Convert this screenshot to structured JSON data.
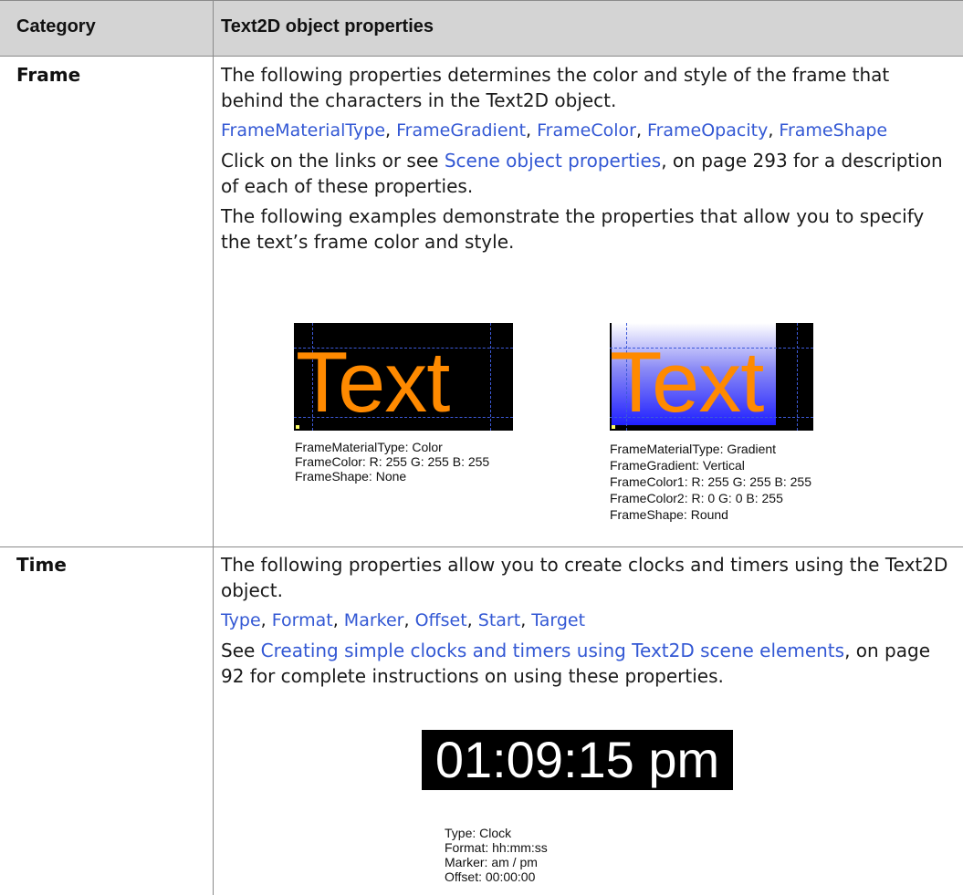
{
  "header": {
    "col1": "Category",
    "col2": "Text2D object properties"
  },
  "frame_row": {
    "category": "Frame",
    "intro": "The following properties determines the color and style of the frame that behind the characters in the Text2D object.",
    "links": [
      "FrameMaterialType",
      "FrameGradient",
      "FrameColor",
      "FrameOpacity",
      "FrameShape"
    ],
    "see_prefix": "Click on the links or see ",
    "see_link": "Scene object properties",
    "see_suffix": ", on page 293 for a description of each of these properties.",
    "examples_text": "The following examples demonstrate the properties that allow you to specify the text’s frame color and style.",
    "example1": {
      "image_text": "Text",
      "caption": [
        "FrameMaterialType: Color",
        "FrameColor: R: 255 G: 255 B: 255",
        "FrameShape: None"
      ]
    },
    "example2": {
      "image_text": "Text",
      "caption": [
        "FrameMaterialType: Gradient",
        "FrameGradient: Vertical",
        "FrameColor1: R: 255 G: 255 B: 255",
        "FrameColor2: R: 0 G: 0 B: 255",
        "FrameShape: Round"
      ]
    }
  },
  "time_row": {
    "category": "Time",
    "intro": "The following properties allow you to create clocks and timers using the Text2D object.",
    "links": [
      "Type",
      "Format",
      "Marker",
      "Offset",
      "Start",
      "Target"
    ],
    "see_prefix": "See ",
    "see_link": "Creating simple clocks and timers using Text2D scene elements",
    "see_suffix": ", on page 92 for complete instructions on using these properties.",
    "example": {
      "image_text": "01:09:15 pm",
      "caption": [
        "Type: Clock",
        "Format: hh:mm:ss",
        "Marker: am / pm",
        "Offset: 00:00:00"
      ]
    }
  },
  "colors": {
    "link": "#3358d4",
    "header_bg": "#d4d4d4",
    "text_orange": "#ff8a00"
  }
}
